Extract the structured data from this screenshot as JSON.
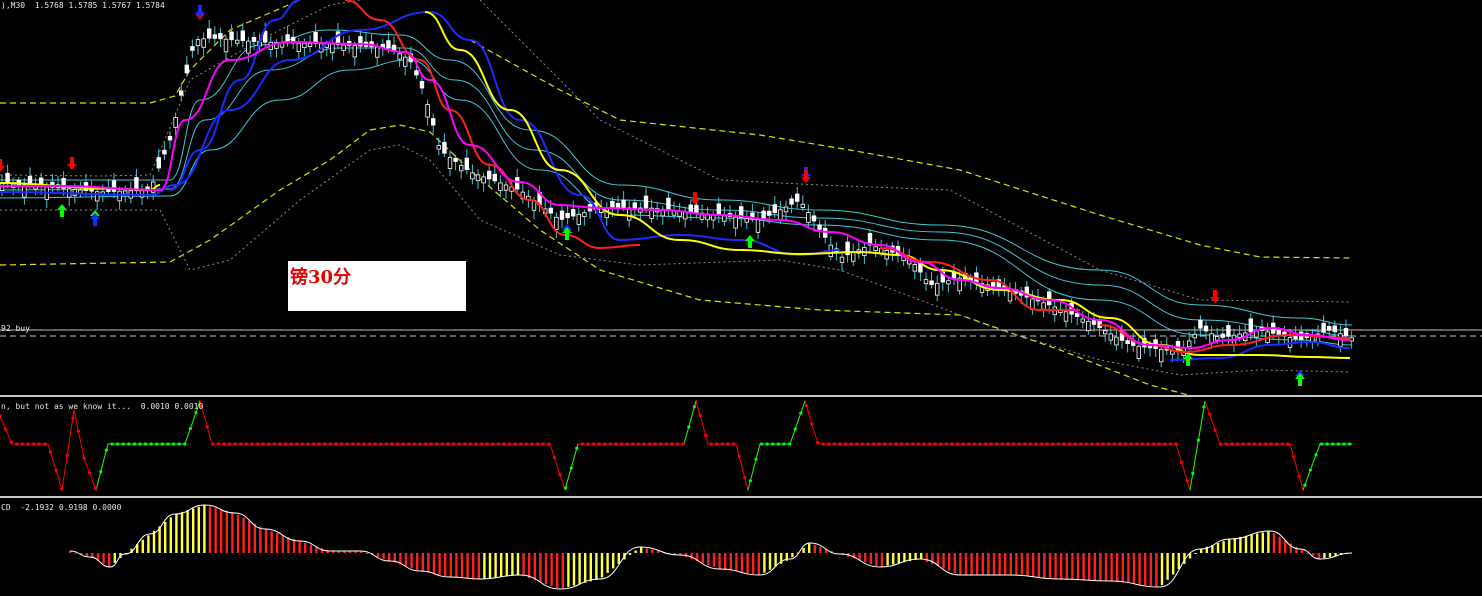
{
  "main_pane": {
    "symbol_label": "),M30",
    "ohlc_values": "1.5768 1.5785 1.5767 1.5784",
    "order_line_label": "92 buy",
    "note_text": "镑30分"
  },
  "signal_pane": {
    "label": "n, but not as we know it...",
    "values": "0.0010 0.0010"
  },
  "macd_pane": {
    "label": "CD",
    "values": "-2.1932 0.9198 0.0000"
  },
  "colors": {
    "background": "#000000",
    "bull_candle": "#ffffff",
    "bear_candle": "#ffffff",
    "ma_fast": "#ff00ff",
    "ma_red": "#ff2020",
    "ma_blue": "#1a2bff",
    "ma_yellow": "#ffff00",
    "bands_cyan": "#40c8d8",
    "envelope_yellow": "#e0e000",
    "envelope_gray": "#8a8a8a",
    "arrow_up_green": "#00ff00",
    "arrow_up_blue": "#1a2bff",
    "arrow_down_red": "#ff0000",
    "signal_red": "#ff0000",
    "signal_green": "#00ff00",
    "hist_yellow": "#ffff40",
    "hist_red": "#ff2020",
    "macd_line": "#ffffff"
  }
}
